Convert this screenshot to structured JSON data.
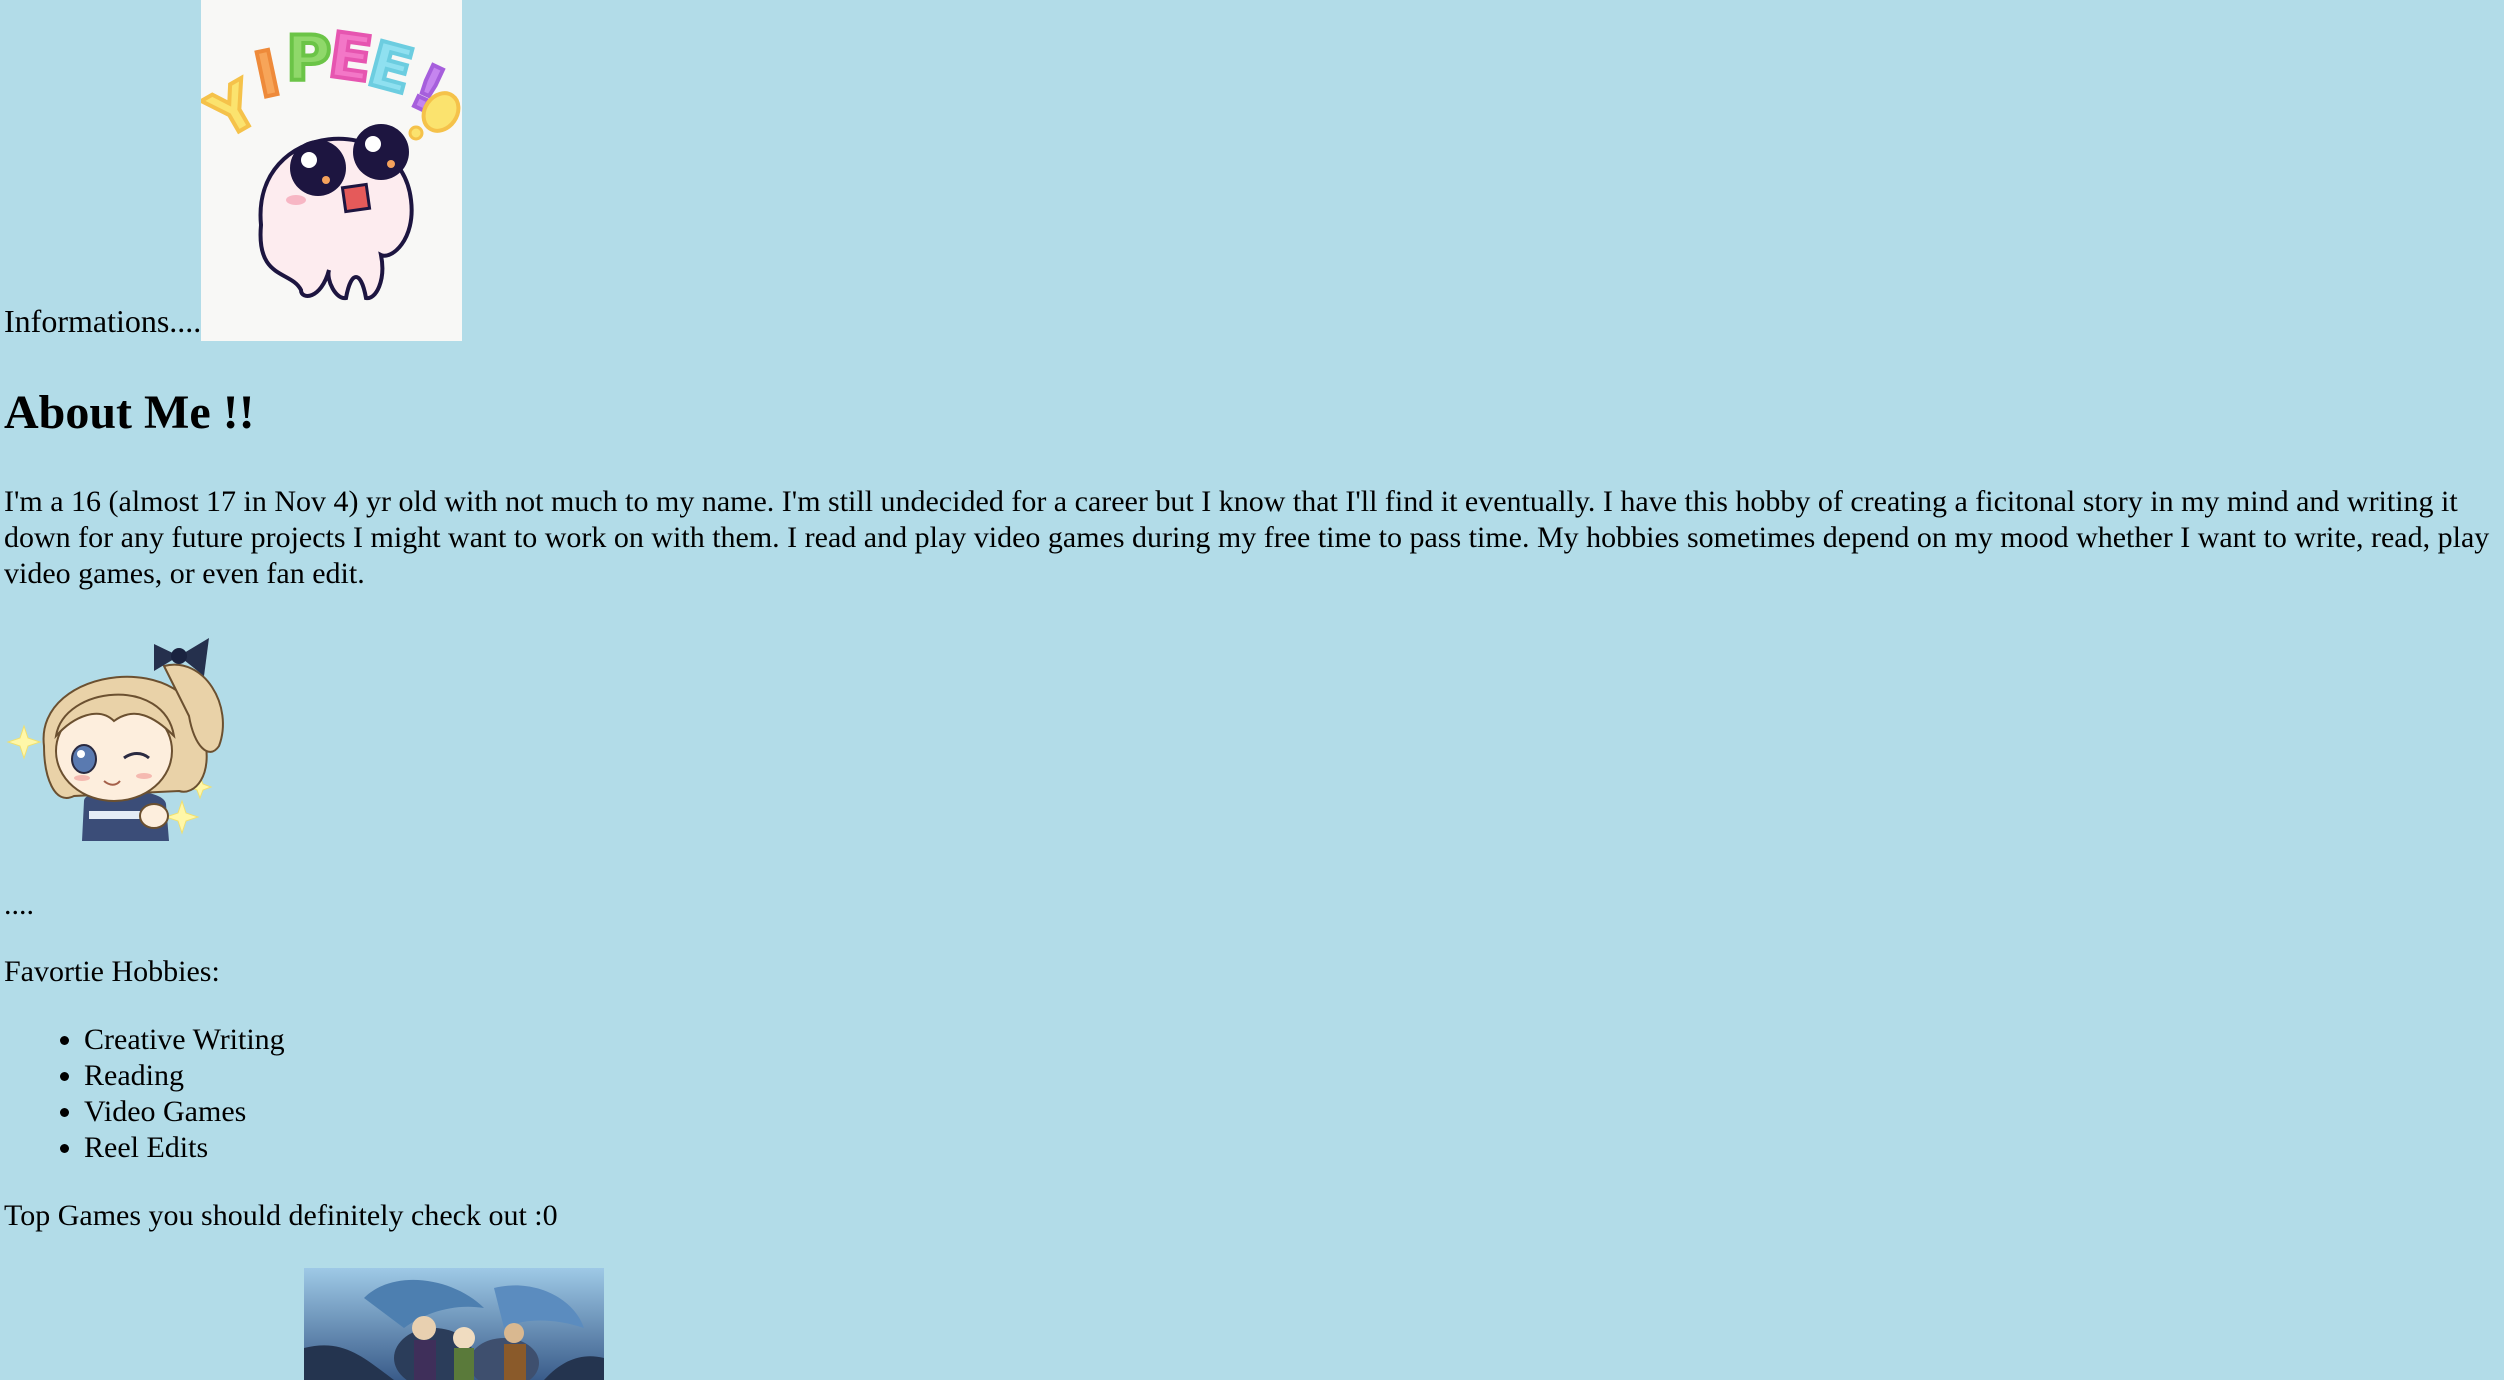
{
  "header": {
    "intro_text": "Informations....",
    "sticker_lettering": "YIPEE!"
  },
  "about": {
    "title": "About Me !!",
    "bio": "I'm a 16 (almost 17 in Nov 4) yr old with not much to my name. I'm still undecided for a career but I know that I'll find it eventually. I have this hobby of creating a ficitonal story in my mind and writing it down for any future projects I might want to work on with them. I read and play video games during my free time to pass time. My hobbies sometimes depend on my mood whether I want to write, read, play video games, or even fan edit."
  },
  "separator": "....",
  "hobbies": {
    "title": "Favortie Hobbies:",
    "items": [
      "Creative Writing",
      "Reading",
      "Video Games",
      "Reel Edits"
    ]
  },
  "games": {
    "title": "Top Games you should definitely check out :0"
  },
  "colors": {
    "background": "#b2dce8"
  }
}
